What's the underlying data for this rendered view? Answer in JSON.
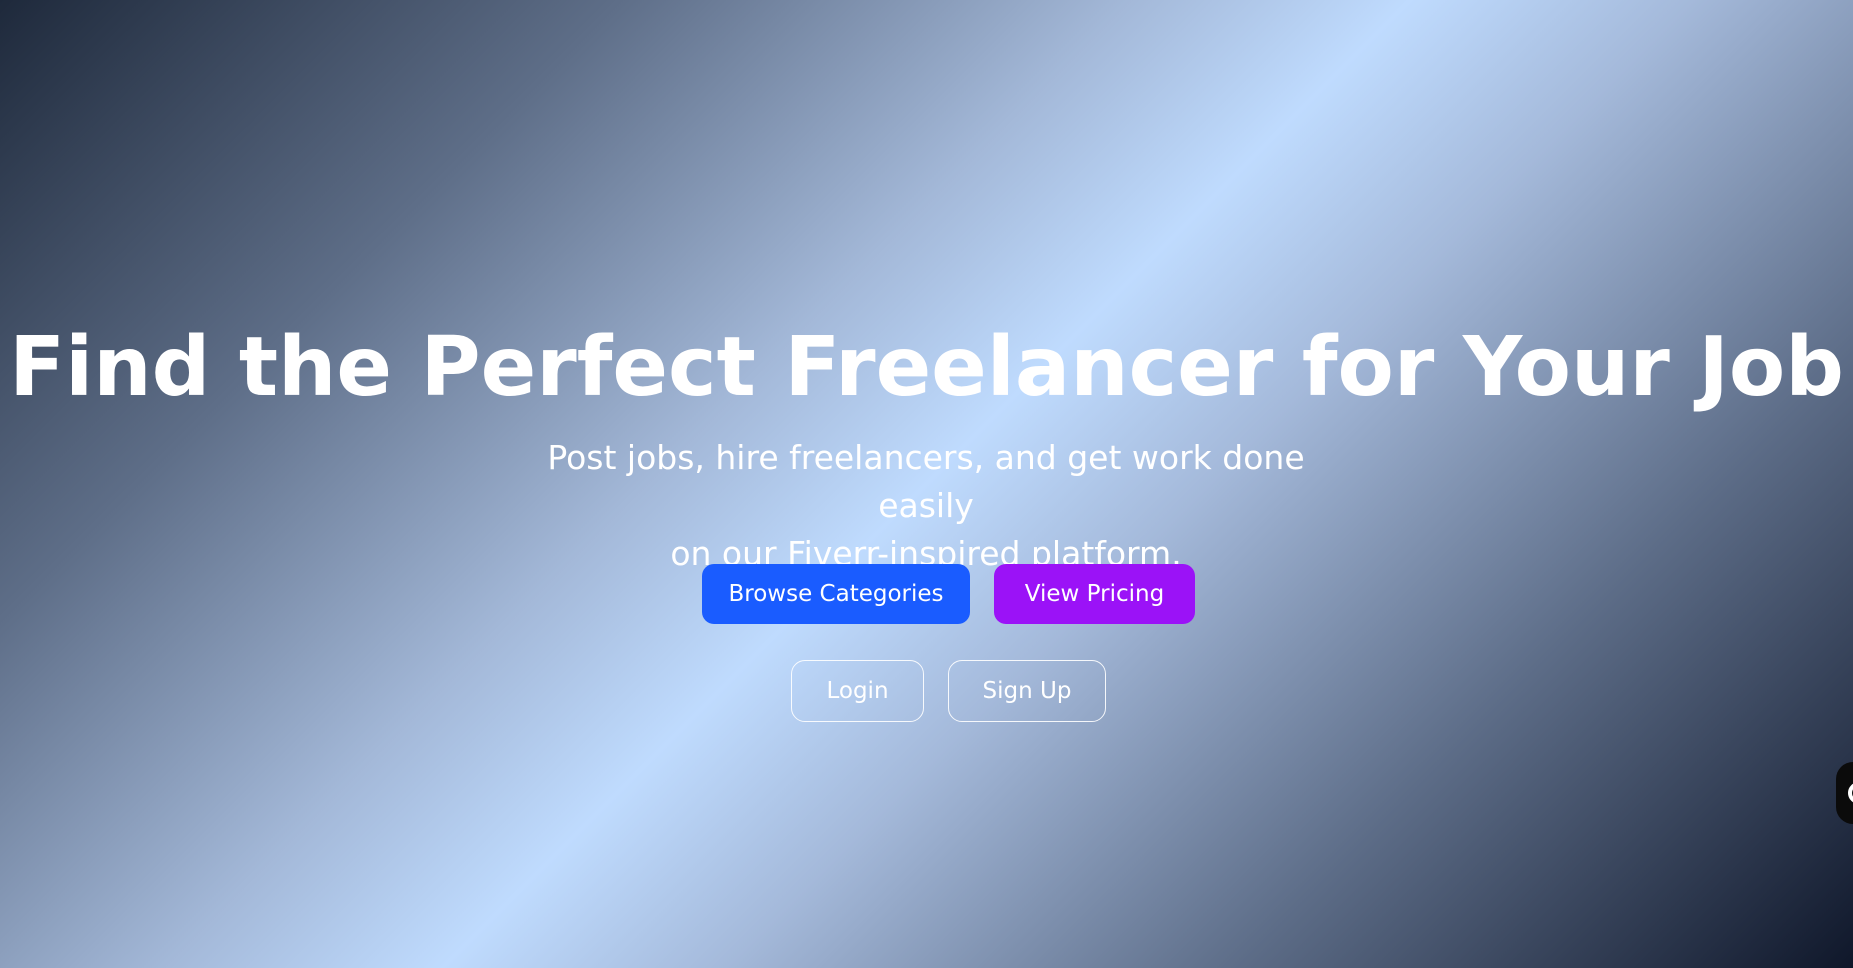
{
  "hero": {
    "headline": "Find the Perfect Freelancer for Your Job",
    "subtitle_line1": "Post jobs, hire freelancers, and get work done easily",
    "subtitle_line2": "on our Fiverr-inspired platform."
  },
  "actions": {
    "browse_label": "Browse Categories",
    "pricing_label": "View Pricing",
    "login_label": "Login",
    "signup_label": "Sign Up"
  },
  "colors": {
    "browse_button": "#1a5cff",
    "pricing_button": "#9b12f7",
    "text": "#ffffff"
  },
  "widgets": {
    "chat_icon": "chat-bubble-icon"
  }
}
